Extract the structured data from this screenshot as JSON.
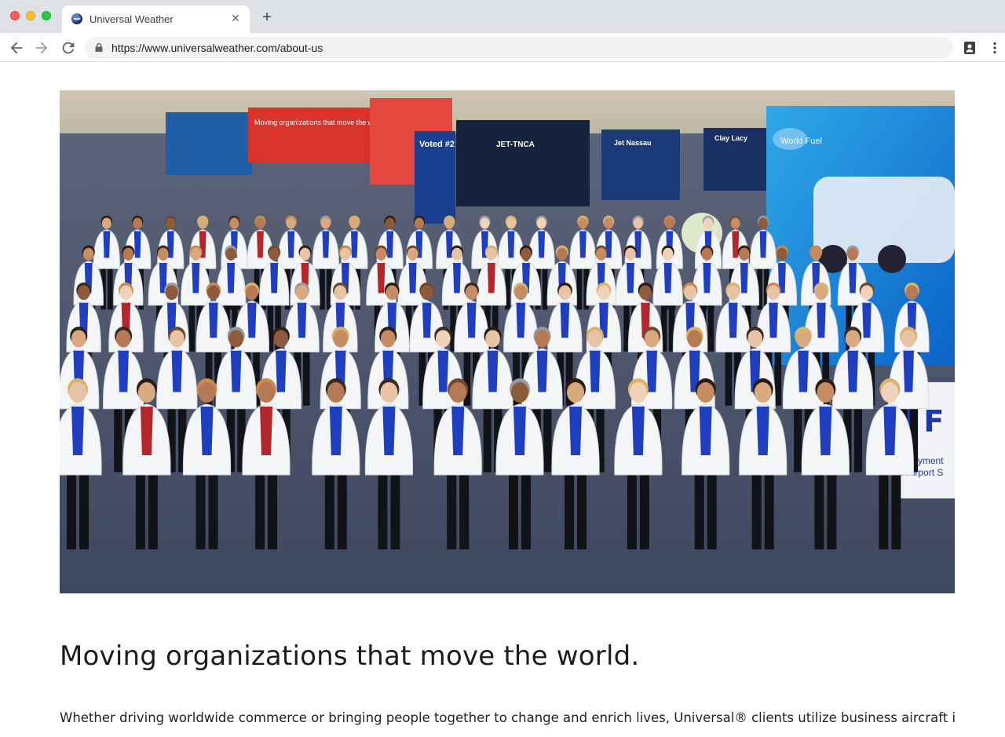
{
  "browser": {
    "tab_title": "Universal Weather",
    "url": "https://www.universalweather.com/about-us",
    "icons": [
      "back-icon",
      "forward-icon",
      "reload-icon",
      "lock-icon",
      "profile-icon",
      "menu-icon",
      "close-icon",
      "plus-icon"
    ]
  },
  "hero": {
    "signs": {
      "voted": "Voted #2",
      "jet_tnca": "JET-TNCA",
      "jet_nassau": "Jet Nassau",
      "clay_lacy": "Clay Lacy",
      "moving": "Moving organizations that move the world",
      "world_fuel": "World Fuel",
      "booth_big": "d F",
      "booth_line1": "rt  •  Payment",
      "booth_line2": "and Airport S"
    }
  },
  "content": {
    "headline": "Moving organizations that move the world.",
    "paragraph": "Whether driving worldwide commerce or bringing people together to change and enrich lives, Universal® clients utilize business aircraft in ways"
  }
}
